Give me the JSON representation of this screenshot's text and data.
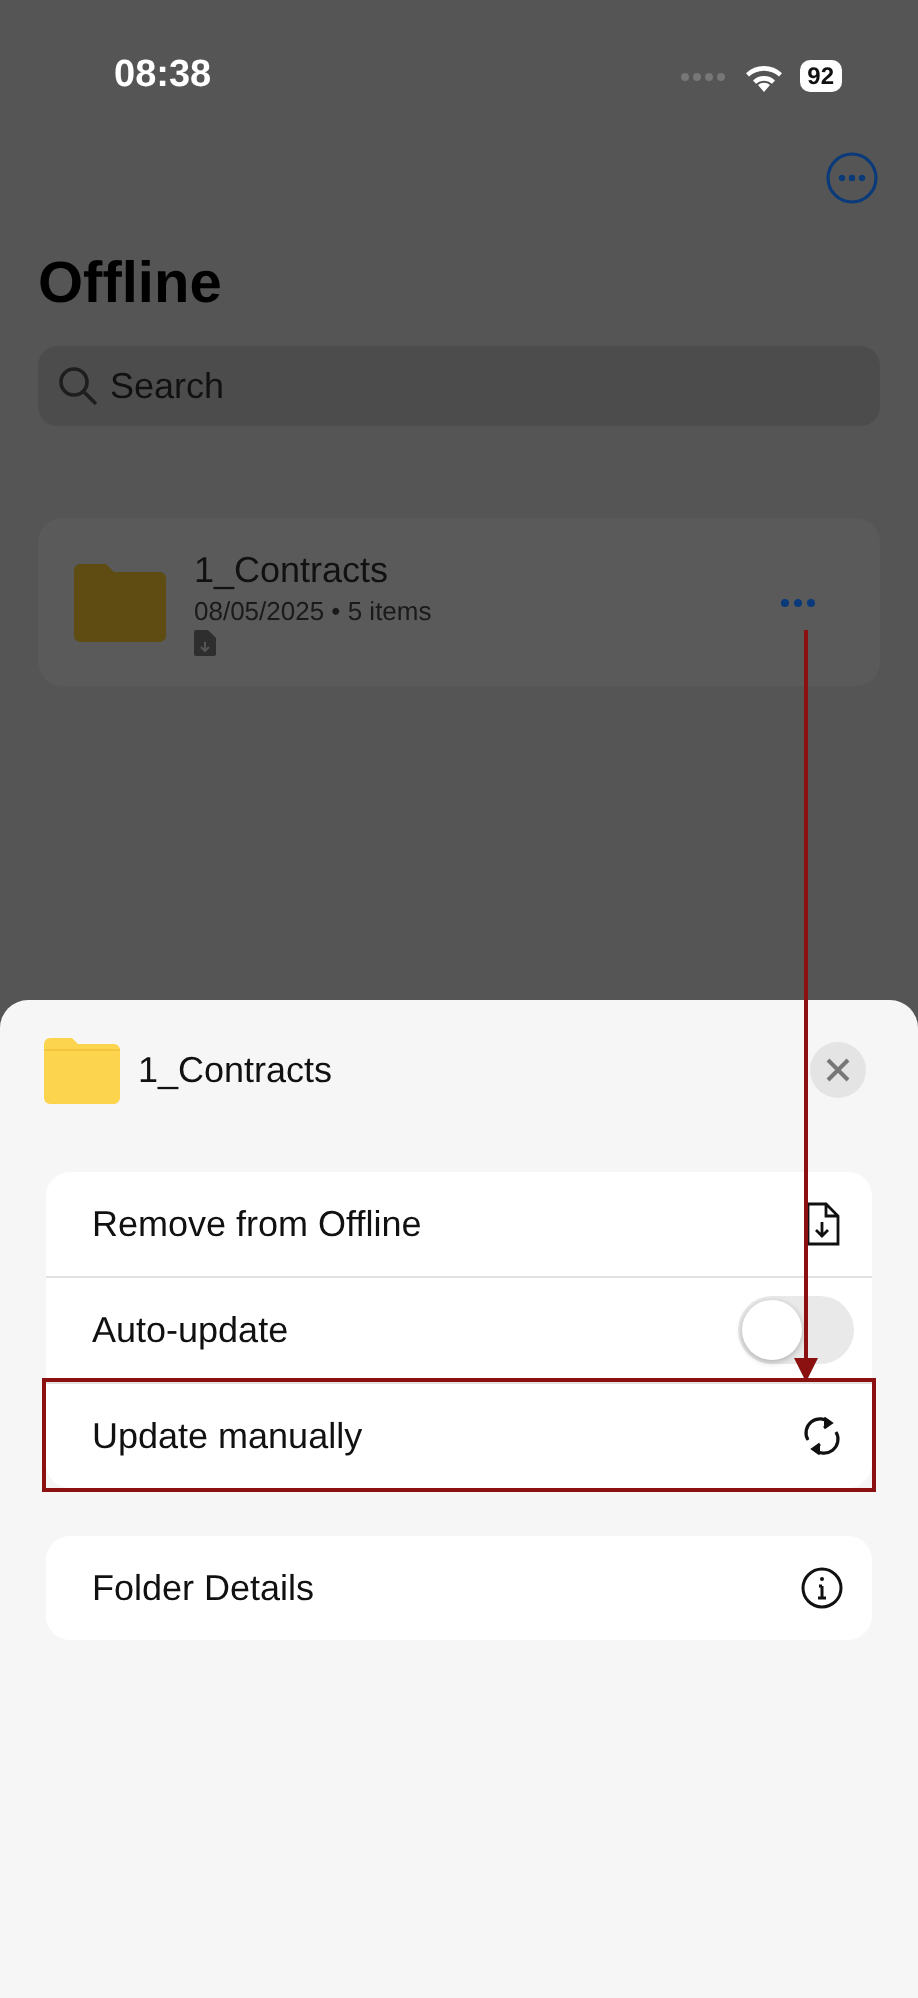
{
  "status_bar": {
    "time": "08:38",
    "battery": "92"
  },
  "page": {
    "title": "Offline",
    "search": {
      "placeholder": "Search"
    },
    "items": [
      {
        "name": "1_Contracts",
        "meta": "08/05/2025 • 5 items"
      }
    ]
  },
  "sheet": {
    "title": "1_Contracts",
    "groups": [
      [
        {
          "kind": "file",
          "label": "Remove from Offline",
          "highlighted": false
        },
        {
          "kind": "toggle",
          "label": "Auto-update",
          "on": false,
          "highlighted": false
        },
        {
          "kind": "refresh",
          "label": "Update manually",
          "highlighted": true
        }
      ],
      [
        {
          "kind": "info",
          "label": "Folder Details",
          "highlighted": false
        }
      ]
    ]
  }
}
